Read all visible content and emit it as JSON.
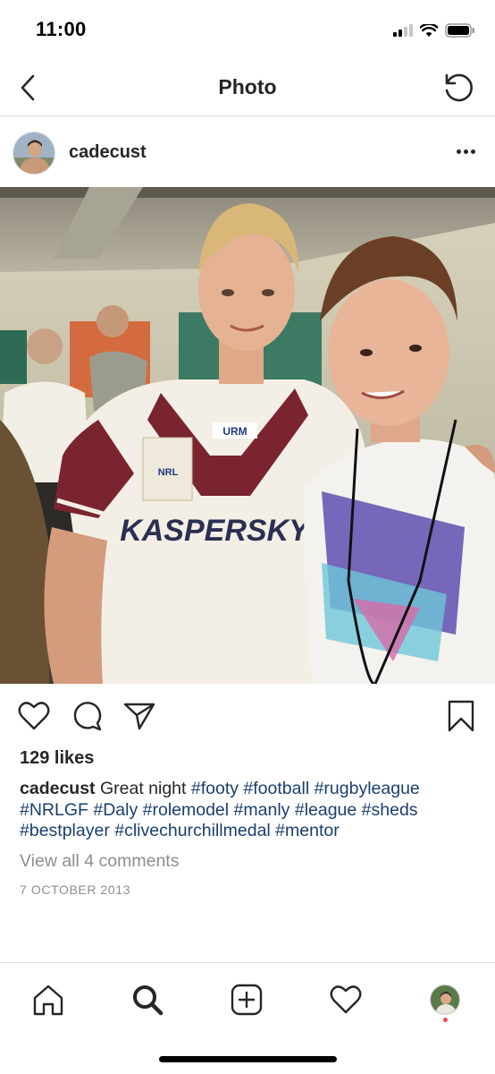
{
  "status_bar": {
    "time": "11:00"
  },
  "nav": {
    "title": "Photo",
    "back_icon": "chevron-left-icon",
    "refresh_icon": "refresh-icon"
  },
  "post": {
    "username": "cadecust",
    "likes": "129 likes",
    "caption_user": "cadecust",
    "caption_text": "Great night",
    "hashtags": [
      "#footy",
      "#football",
      "#rugbyleague",
      "#NRLGF",
      "#Daly",
      "#rolemodel",
      "#manly",
      "#league",
      "#sheds",
      "#bestplayer",
      "#clivechurchillmedal",
      "#mentor"
    ],
    "view_comments": "View all 4 comments",
    "date": "7 OCTOBER 2013"
  },
  "photo": {
    "jersey_sponsor": "KASPERSKY",
    "jersey_logo": "URM",
    "jersey_badge": "NRL"
  },
  "tabbar": {
    "items": [
      "home-icon",
      "search-icon",
      "add-post-icon",
      "activity-heart-icon",
      "profile-avatar"
    ]
  },
  "colors": {
    "hashtag": "#1a3f6e",
    "secondary_text": "#8e8e8e",
    "divider": "#dbdbdb",
    "notif_dot": "#ed4956"
  }
}
